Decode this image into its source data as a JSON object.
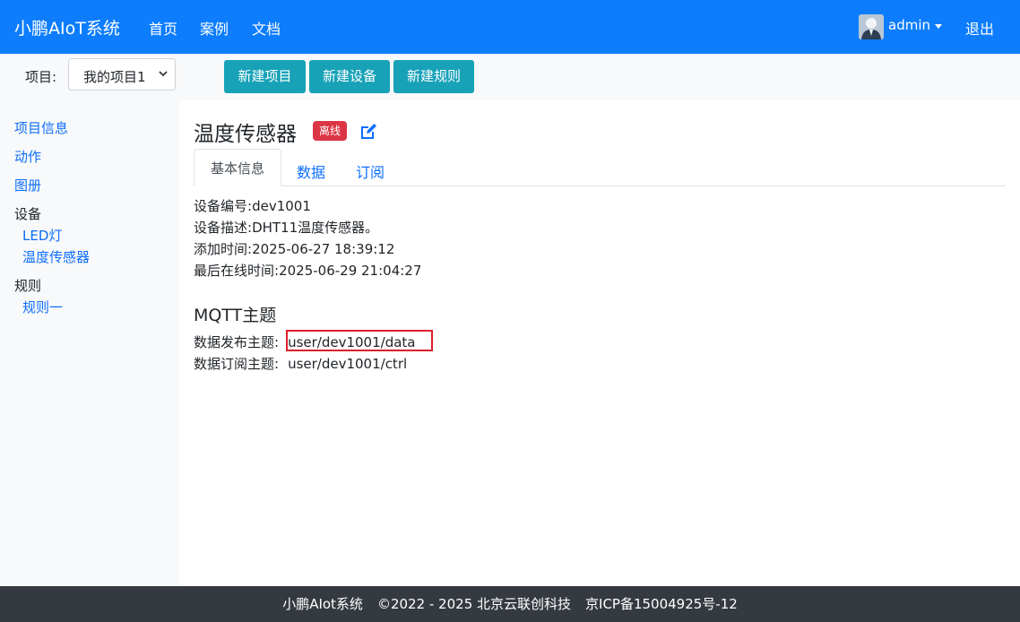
{
  "navbar": {
    "brand": "小鹏AIoT系统",
    "links": [
      "首页",
      "案例",
      "文档"
    ],
    "user": "admin",
    "logout": "退出"
  },
  "toolbar": {
    "project_label": "项目:",
    "project_selected": "我的项目1",
    "buttons": [
      "新建项目",
      "新建设备",
      "新建规则"
    ]
  },
  "sidebar": {
    "items": [
      "项目信息",
      "动作",
      "图册"
    ],
    "devices_header": "设备",
    "devices": [
      "LED灯",
      "温度传感器"
    ],
    "rules_header": "规则",
    "rules": [
      "规则一"
    ]
  },
  "device": {
    "title": "温度传感器",
    "status_badge": "离线",
    "tabs": [
      "基本信息",
      "数据",
      "订阅"
    ],
    "info": [
      {
        "label": "设备编号:",
        "value": "dev1001"
      },
      {
        "label": "设备描述:",
        "value": "DHT11温度传感器。"
      },
      {
        "label": "添加时间:",
        "value": "2025-06-27 18:39:12"
      },
      {
        "label": "最后在线时间:",
        "value": "2025-06-29 21:04:27"
      }
    ],
    "mqtt_title": "MQTT主题",
    "mqtt": [
      {
        "label": "数据发布主题:",
        "value": "user/dev1001/data"
      },
      {
        "label": "数据订阅主题:",
        "value": "user/dev1001/ctrl"
      }
    ]
  },
  "footer": {
    "brand": "小鹏AIot系统",
    "copyright": "©2022 - 2025 北京云联创科技",
    "icp": "京ICP备15004925号-12"
  },
  "colors": {
    "navbar": "#0d7dfd",
    "button": "#17a2b8",
    "badge": "#dc3545",
    "link": "#0d6efd",
    "footer": "#343a40",
    "highlight": "#dc1f2b"
  },
  "icons": [
    "avatar-icon",
    "caret-down-icon",
    "chevron-down-icon",
    "edit-icon"
  ]
}
